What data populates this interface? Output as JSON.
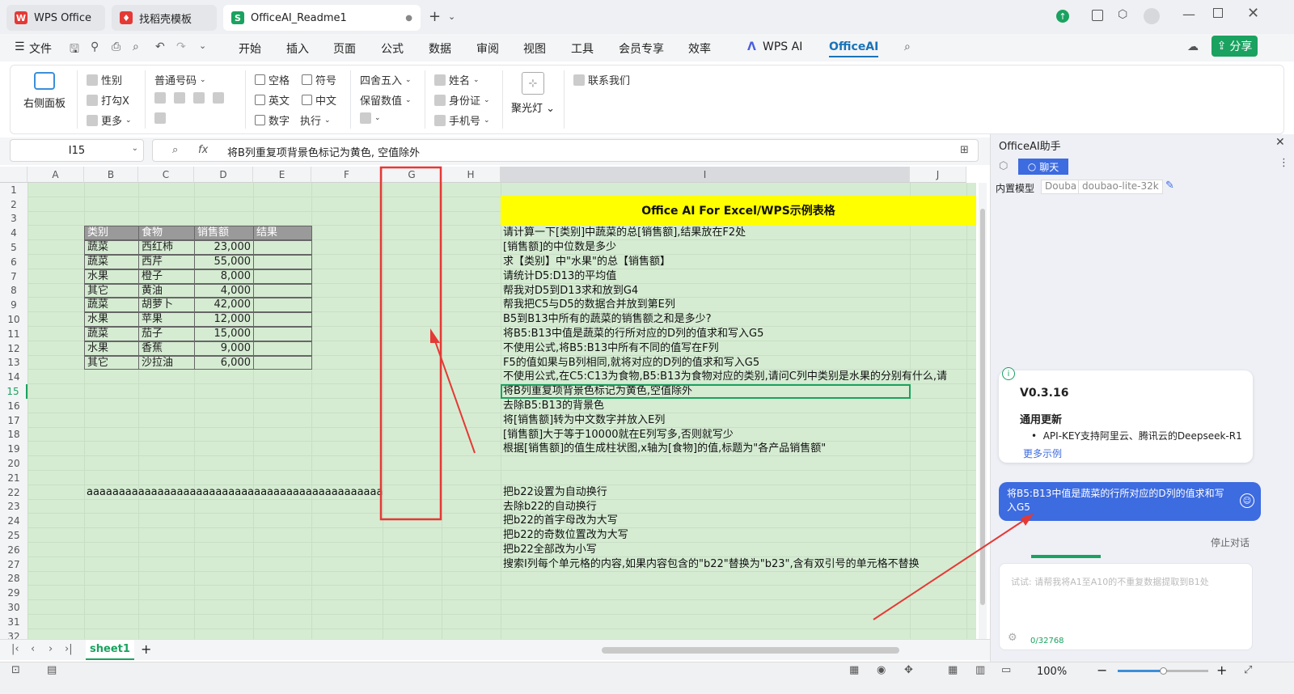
{
  "tabs": [
    {
      "label": "WPS Office"
    },
    {
      "label": "找稻壳模板"
    },
    {
      "label": "OfficeAI_Readme1"
    }
  ],
  "menu": {
    "file": "文件",
    "items": [
      "开始",
      "插入",
      "页面",
      "公式",
      "数据",
      "审阅",
      "视图",
      "工具",
      "会员专享",
      "效率"
    ],
    "wps_ai": "WPS AI",
    "office_ai": "OfficeAI",
    "share": "分享"
  },
  "ribbon": {
    "right_panel": "右侧面板",
    "gender": "性别",
    "tick": "打勾X",
    "more": "更多",
    "normal_number": "普通号码",
    "space": "空格",
    "symbol": "符号",
    "english": "英文",
    "chinese": "中文",
    "digit": "数字",
    "execute": "执行",
    "round": "四舍五入",
    "keep_value": "保留数值",
    "name": "姓名",
    "id_card": "身份证",
    "phone": "手机号",
    "spotlight": "聚光灯",
    "contact": "联系我们"
  },
  "formula": {
    "cell_ref": "I15",
    "fx": "fx",
    "content": "将B列重复项背景色标记为黄色, 空值除外"
  },
  "columns": [
    "A",
    "B",
    "C",
    "D",
    "E",
    "F",
    "G",
    "H",
    "I",
    "J"
  ],
  "rows": [
    "1",
    "2",
    "3",
    "4",
    "5",
    "6",
    "7",
    "8",
    "9",
    "10",
    "11",
    "12",
    "13",
    "14",
    "15",
    "16",
    "17",
    "18",
    "19",
    "20",
    "21",
    "22",
    "23",
    "24",
    "25",
    "26",
    "27",
    "28",
    "29",
    "30",
    "31",
    "32"
  ],
  "table": {
    "headers": [
      "类别",
      "食物",
      "销售额",
      "结果"
    ],
    "rows": [
      [
        "蔬菜",
        "西红柿",
        "23,000"
      ],
      [
        "蔬菜",
        "西芹",
        "55,000"
      ],
      [
        "水果",
        "橙子",
        "8,000"
      ],
      [
        "其它",
        "黄油",
        "4,000"
      ],
      [
        "蔬菜",
        "胡萝卜",
        "42,000"
      ],
      [
        "水果",
        "苹果",
        "12,000"
      ],
      [
        "蔬菜",
        "茄子",
        "15,000"
      ],
      [
        "水果",
        "香蕉",
        "9,000"
      ],
      [
        "其它",
        "沙拉油",
        "6,000"
      ]
    ]
  },
  "b22": "aaaaaaaaaaaaaaaaaaaaaaaaaaaaaaaaaaaaaaaaaaaaaa",
  "banner": "Office AI For Excel/WPS示例表格",
  "prompts_i": [
    {
      "row": "4",
      "text": "请计算一下[类别]中蔬菜的总[销售额],结果放在F2处"
    },
    {
      "row": "5",
      "text": "[销售额]的中位数是多少"
    },
    {
      "row": "6",
      "text": "求【类别】中\"水果\"的总【销售额】"
    },
    {
      "row": "7",
      "text": "请统计D5:D13的平均值"
    },
    {
      "row": "8",
      "text": "帮我对D5到D13求和放到G4"
    },
    {
      "row": "9",
      "text": "帮我把C5与D5的数据合并放到第E列"
    },
    {
      "row": "10",
      "text": "B5到B13中所有的蔬菜的销售额之和是多少?"
    },
    {
      "row": "11",
      "text": "将B5:B13中值是蔬菜的行所对应的D列的值求和写入G5"
    },
    {
      "row": "12",
      "text": "不使用公式,将B5:B13中所有不同的值写在F列"
    },
    {
      "row": "13",
      "text": "F5的值如果与B列相同,就将对应的D列的值求和写入G5"
    },
    {
      "row": "14",
      "text": "不使用公式,在C5:C13为食物,B5:B13为食物对应的类别,请问C列中类别是水果的分别有什么,请"
    },
    {
      "row": "15",
      "text": "将B列重复项背景色标记为黄色,空值除外"
    },
    {
      "row": "16",
      "text": "去除B5:B13的背景色"
    },
    {
      "row": "17",
      "text": "将[销售额]转为中文数字并放入E列"
    },
    {
      "row": "18",
      "text": "[销售额]大于等于10000就在E列写多,否则就写少"
    },
    {
      "row": "19",
      "text": "根据[销售额]的值生成柱状图,x轴为[食物]的值,标题为\"各产品销售额\""
    },
    {
      "row": "22",
      "text": "把b22设置为自动换行"
    },
    {
      "row": "23",
      "text": "去除b22的自动换行"
    },
    {
      "row": "24",
      "text": "把b22的首字母改为大写"
    },
    {
      "row": "25",
      "text": "把b22的奇数位置改为大写"
    },
    {
      "row": "26",
      "text": "把b22全部改为小写"
    },
    {
      "row": "27",
      "text": "搜索I列每个单元格的内容,如果内容包含的\"b22\"替换为\"b23\",含有双引号的单元格不替换"
    }
  ],
  "sheet": {
    "name": "sheet1"
  },
  "status": {
    "zoom": "100%"
  },
  "panel": {
    "title": "OfficeAI助手",
    "chat": "聊天",
    "model_label": "内置模型",
    "model_vendor": "Douba",
    "model_name": "doubao-lite-32k",
    "version": "V0.3.16",
    "update_title": "通用更新",
    "update_item": "API-KEY支持阿里云、腾讯云的Deepseek-R1",
    "more_examples": "更多示例",
    "user_msg": "将B5:B13中值是蔬菜的行所对应的D列的值求和写入G5",
    "stop": "停止对话",
    "input_placeholder": "试试: 请帮我将A1至A10的不重复数据提取到B1处",
    "counter": "0/32768"
  },
  "colors": {
    "accent": "#1aa260",
    "grid_bg": "#d5ecd2",
    "banner": "#ffff00",
    "header_gray": "#9a9a9a",
    "annotation": "#e53935",
    "user_bubble": "#3d6be0"
  }
}
